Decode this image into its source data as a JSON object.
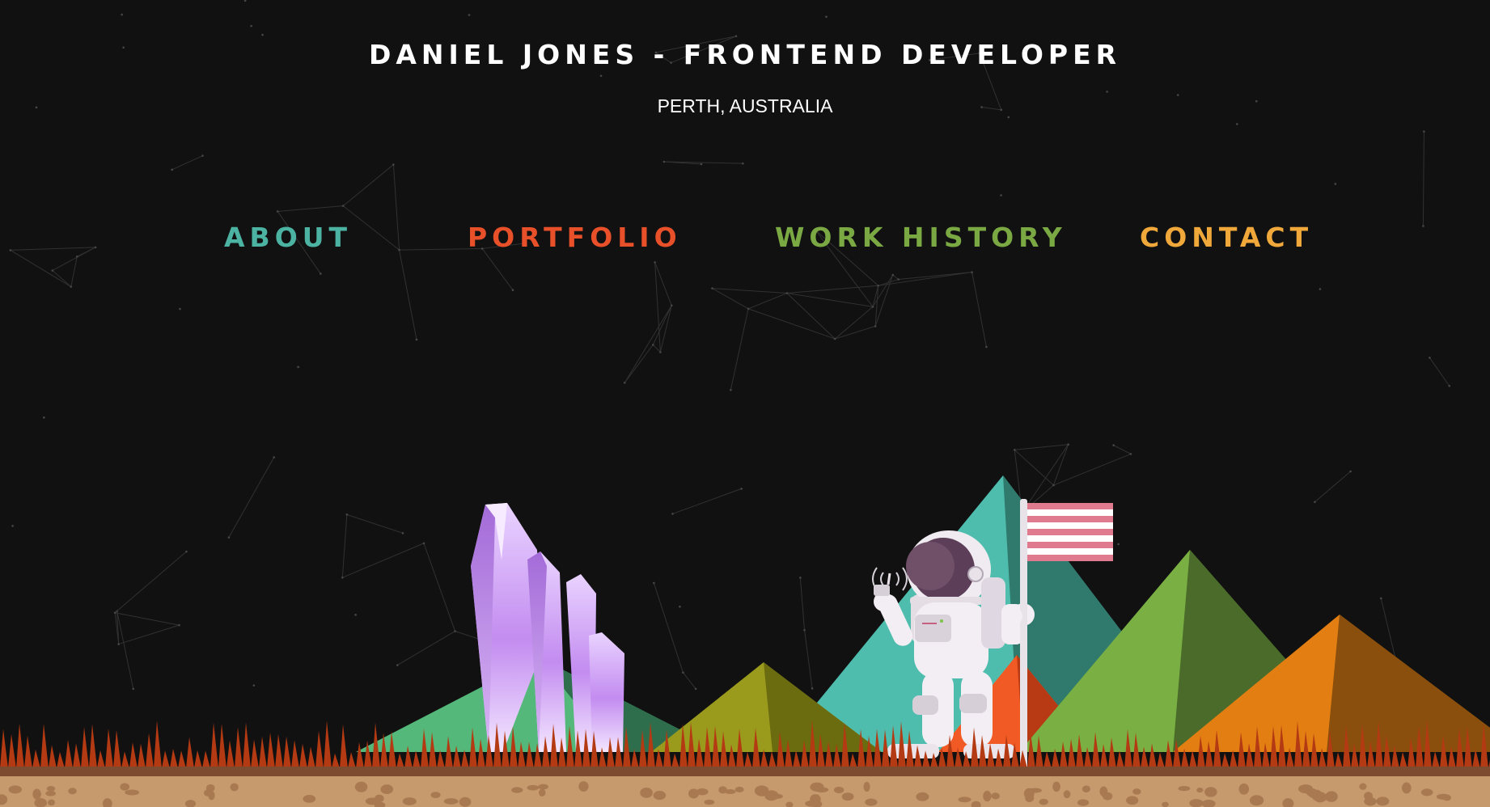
{
  "header": {
    "title": "DANIEL JONES - FRONTEND DEVELOPER",
    "location": "PERTH, AUSTRALIA"
  },
  "nav": {
    "about": {
      "label": "ABOUT",
      "color": "#4cb3a3"
    },
    "portfolio": {
      "label": "PORTFOLIO",
      "color": "#e8502a"
    },
    "work_history": {
      "label": "WORK HISTORY",
      "color": "#7aa843"
    },
    "contact": {
      "label": "CONTACT",
      "color": "#f0a83a"
    }
  },
  "illustration": {
    "elements": [
      "constellation-network",
      "crystal-cluster",
      "mountain-range",
      "astronaut",
      "striped-flag",
      "orange-grass",
      "dirt-ground"
    ],
    "palette": {
      "background": "#111111",
      "teal": "#4cb3a3",
      "green": "#7aa843",
      "olive": "#9a9a1c",
      "orange": "#e97f1a",
      "red": "#e8502a",
      "grass": "#b33a12",
      "dirt": "#c69a6c",
      "crystal": "#c59ef0",
      "flag_stripe": "#e07b8f"
    }
  }
}
